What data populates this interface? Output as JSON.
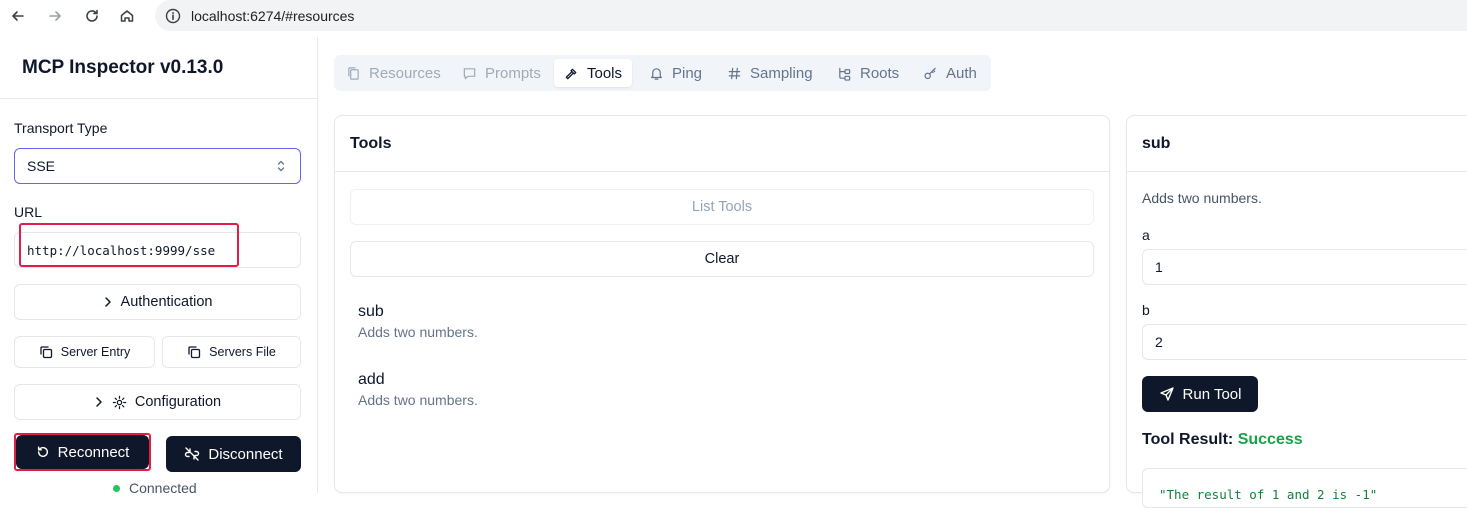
{
  "browser": {
    "url": "localhost:6274/#resources"
  },
  "sidebar": {
    "title": "MCP Inspector v0.13.0",
    "transport_label": "Transport Type",
    "transport_value": "SSE",
    "url_label": "URL",
    "url_value": "http://localhost:9999/sse",
    "authentication_label": "Authentication",
    "server_entry_label": "Server Entry",
    "servers_file_label": "Servers File",
    "configuration_label": "Configuration",
    "reconnect_label": "Reconnect",
    "disconnect_label": "Disconnect",
    "status_text": "Connected"
  },
  "tabs": [
    {
      "label": "Resources",
      "icon": "file-icon",
      "state": "disabled"
    },
    {
      "label": "Prompts",
      "icon": "message-icon",
      "state": "disabled"
    },
    {
      "label": "Tools",
      "icon": "hammer-icon",
      "state": "active"
    },
    {
      "label": "Ping",
      "icon": "bell-icon",
      "state": "normal"
    },
    {
      "label": "Sampling",
      "icon": "hash-icon",
      "state": "normal"
    },
    {
      "label": "Roots",
      "icon": "tree-icon",
      "state": "normal"
    },
    {
      "label": "Auth",
      "icon": "key-icon",
      "state": "normal"
    }
  ],
  "tools_panel": {
    "title": "Tools",
    "list_tools_label": "List Tools",
    "clear_label": "Clear",
    "items": [
      {
        "name": "sub",
        "description": "Adds two numbers."
      },
      {
        "name": "add",
        "description": "Adds two numbers."
      }
    ]
  },
  "detail_panel": {
    "title": "sub",
    "description": "Adds two numbers.",
    "params": [
      {
        "label": "a",
        "value": "1"
      },
      {
        "label": "b",
        "value": "2"
      }
    ],
    "run_label": "Run Tool",
    "result_label": "Tool Result:",
    "result_status": "Success",
    "result_text": "\"The result of 1 and 2 is -1\""
  },
  "colors": {
    "accent_dark": "#0f172a",
    "focus_border": "#6366f1",
    "highlight_red": "#e11d48",
    "success_green": "#16a34a",
    "status_dot": "#22c55e"
  }
}
